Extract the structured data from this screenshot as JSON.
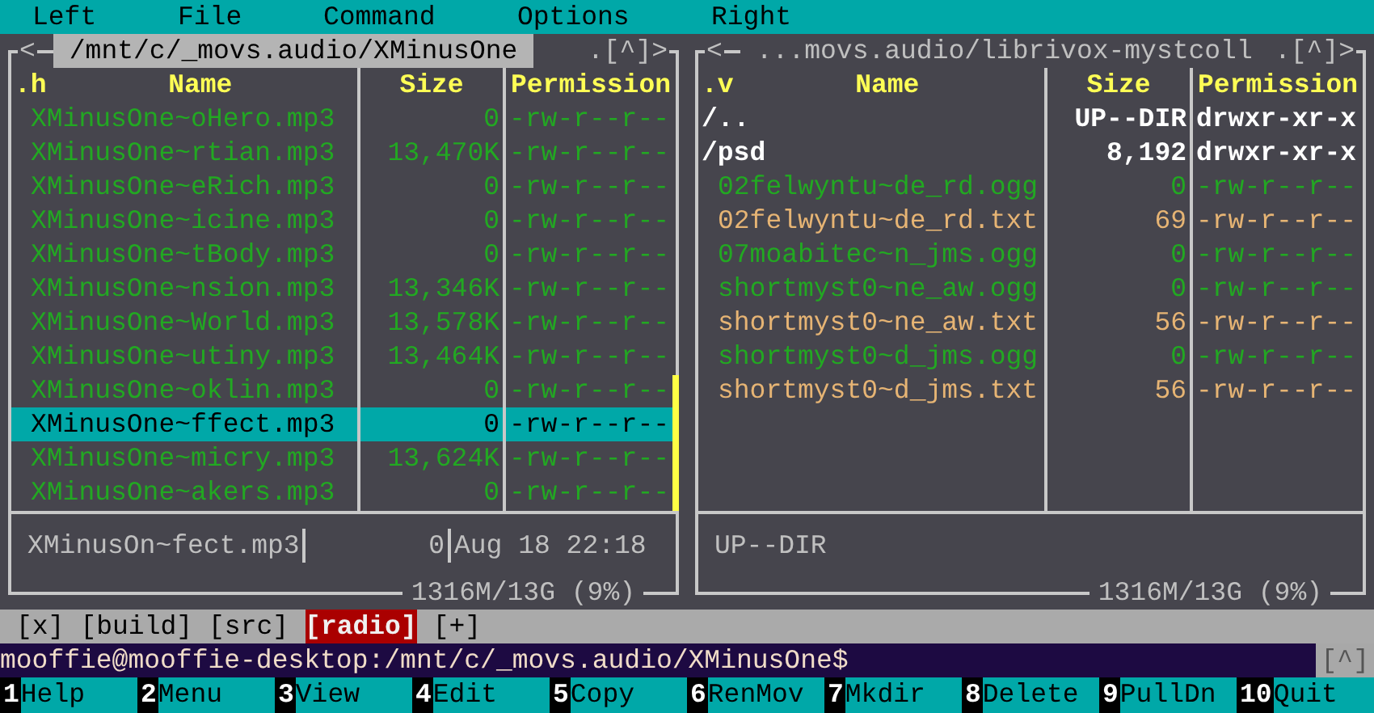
{
  "menu": [
    "Left",
    "File",
    "Command",
    "Options",
    "Right"
  ],
  "panels": [
    {
      "active": true,
      "nav_left": "<",
      "path": "/mnt/c/_movs.audio/XMinusOne",
      "nav_right": ".[^]>",
      "sort": ".h",
      "columns": [
        "Name",
        "Size",
        "Permission"
      ],
      "files": [
        {
          "name": "XMinusOne~oHero.mp3",
          "size": "0",
          "perm": "-rw-r--r--",
          "kind": "audio",
          "selected": false
        },
        {
          "name": "XMinusOne~rtian.mp3",
          "size": "13,470K",
          "perm": "-rw-r--r--",
          "kind": "audio",
          "selected": false
        },
        {
          "name": "XMinusOne~eRich.mp3",
          "size": "0",
          "perm": "-rw-r--r--",
          "kind": "audio",
          "selected": false
        },
        {
          "name": "XMinusOne~icine.mp3",
          "size": "0",
          "perm": "-rw-r--r--",
          "kind": "audio",
          "selected": false
        },
        {
          "name": "XMinusOne~tBody.mp3",
          "size": "0",
          "perm": "-rw-r--r--",
          "kind": "audio",
          "selected": false
        },
        {
          "name": "XMinusOne~nsion.mp3",
          "size": "13,346K",
          "perm": "-rw-r--r--",
          "kind": "audio",
          "selected": false
        },
        {
          "name": "XMinusOne~World.mp3",
          "size": "13,578K",
          "perm": "-rw-r--r--",
          "kind": "audio",
          "selected": false
        },
        {
          "name": "XMinusOne~utiny.mp3",
          "size": "13,464K",
          "perm": "-rw-r--r--",
          "kind": "audio",
          "selected": false
        },
        {
          "name": "XMinusOne~oklin.mp3",
          "size": "0",
          "perm": "-rw-r--r--",
          "kind": "audio",
          "selected": false
        },
        {
          "name": "XMinusOne~ffect.mp3",
          "size": "0",
          "perm": "-rw-r--r--",
          "kind": "audio",
          "selected": true
        },
        {
          "name": "XMinusOne~micry.mp3",
          "size": "13,624K",
          "perm": "-rw-r--r--",
          "kind": "audio",
          "selected": false
        },
        {
          "name": "XMinusOne~akers.mp3",
          "size": "0",
          "perm": "-rw-r--r--",
          "kind": "audio",
          "selected": false
        }
      ],
      "info": [
        "XMinusOn~fect.mp3",
        "0",
        "Aug 18 22:18"
      ],
      "free": "1316M/13G (9%)"
    },
    {
      "active": false,
      "nav_left": "<",
      "path": "...movs.audio/librivox-mystcoll",
      "nav_right": ".[^]>",
      "sort": ".v",
      "columns": [
        "Name",
        "Size",
        "Permission"
      ],
      "files": [
        {
          "name": "/..",
          "size": "UP--DIR",
          "perm": "drwxr-xr-x",
          "kind": "dir",
          "selected": false
        },
        {
          "name": "/psd",
          "size": "8,192",
          "perm": "drwxr-xr-x",
          "kind": "dir",
          "selected": false
        },
        {
          "name": "02felwyntu~de_rd.ogg",
          "size": "0",
          "perm": "-rw-r--r--",
          "kind": "audio",
          "selected": false
        },
        {
          "name": "02felwyntu~de_rd.txt",
          "size": "69",
          "perm": "-rw-r--r--",
          "kind": "text",
          "selected": false
        },
        {
          "name": "07moabitec~n_jms.ogg",
          "size": "0",
          "perm": "-rw-r--r--",
          "kind": "audio",
          "selected": false
        },
        {
          "name": "shortmyst0~ne_aw.ogg",
          "size": "0",
          "perm": "-rw-r--r--",
          "kind": "audio",
          "selected": false
        },
        {
          "name": "shortmyst0~ne_aw.txt",
          "size": "56",
          "perm": "-rw-r--r--",
          "kind": "text",
          "selected": false
        },
        {
          "name": "shortmyst0~d_jms.ogg",
          "size": "0",
          "perm": "-rw-r--r--",
          "kind": "audio",
          "selected": false
        },
        {
          "name": "shortmyst0~d_jms.txt",
          "size": "56",
          "perm": "-rw-r--r--",
          "kind": "text",
          "selected": false
        }
      ],
      "info": [
        "UP--DIR"
      ],
      "free": "1316M/13G (9%)"
    }
  ],
  "tabs": [
    {
      "label": "[x]",
      "selected": false
    },
    {
      "label": "[build]",
      "selected": false
    },
    {
      "label": "[src]",
      "selected": false
    },
    {
      "label": "[radio]",
      "selected": true
    },
    {
      "label": "[+]",
      "selected": false
    }
  ],
  "command_line": {
    "prompt": "mooffie@mooffie-desktop:/mnt/c/_movs.audio/XMinusOne$",
    "button": "[^]"
  },
  "function_keys": [
    {
      "number": "1",
      "label": "Help"
    },
    {
      "number": "2",
      "label": "Menu"
    },
    {
      "number": "3",
      "label": "View"
    },
    {
      "number": "4",
      "label": "Edit"
    },
    {
      "number": "5",
      "label": "Copy"
    },
    {
      "number": "6",
      "label": "RenMov"
    },
    {
      "number": "7",
      "label": "Mkdir"
    },
    {
      "number": "8",
      "label": "Delete"
    },
    {
      "number": "9",
      "label": "PullDn"
    },
    {
      "number": "10",
      "label": "Quit"
    }
  ]
}
